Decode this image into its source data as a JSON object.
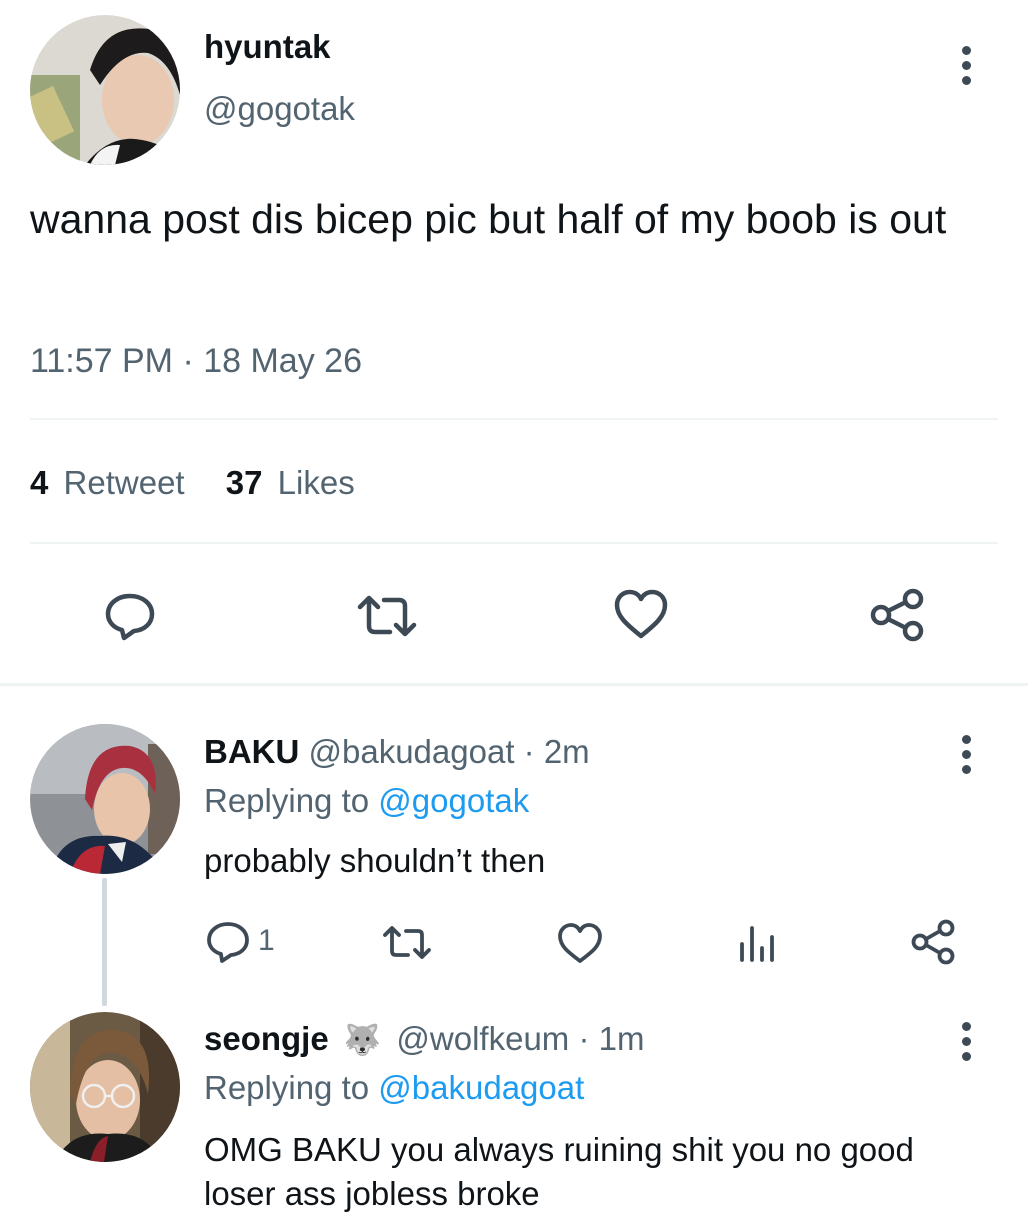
{
  "main_tweet": {
    "display_name": "hyuntak",
    "handle": "@gogotak",
    "text": "wanna post dis bicep pic but half of my boob is out",
    "timestamp": "11:57 PM · 18 May 26",
    "retweet_count": "4",
    "retweet_label": "Retweet",
    "like_count": "37",
    "like_label": "Likes"
  },
  "replies": [
    {
      "display_name": "BAKU",
      "handle": "@bakudagoat",
      "time": " · 2m",
      "replying_to_label": "Replying to",
      "replying_to_handle": "@gogotak",
      "text": "probably shouldn’t then",
      "reply_count": "1"
    },
    {
      "display_name": "seongje",
      "emoji": "🐺",
      "handle": "@wolfkeum",
      "time": " · 1m",
      "replying_to_label": "Replying to",
      "replying_to_handle": "@bakudagoat",
      "text": "OMG BAKU you always ruining shit you no good loser ass jobless broke"
    }
  ],
  "icons": {
    "reply": "reply-bubble-icon",
    "retweet": "retweet-arrows-icon",
    "like": "heart-icon",
    "share": "share-nodes-icon",
    "analytics": "bar-chart-icon",
    "more": "vertical-ellipsis-icon"
  },
  "colors": {
    "link": "#1d9bf0",
    "secondary_text": "#536471",
    "divider": "#eff3f4"
  }
}
